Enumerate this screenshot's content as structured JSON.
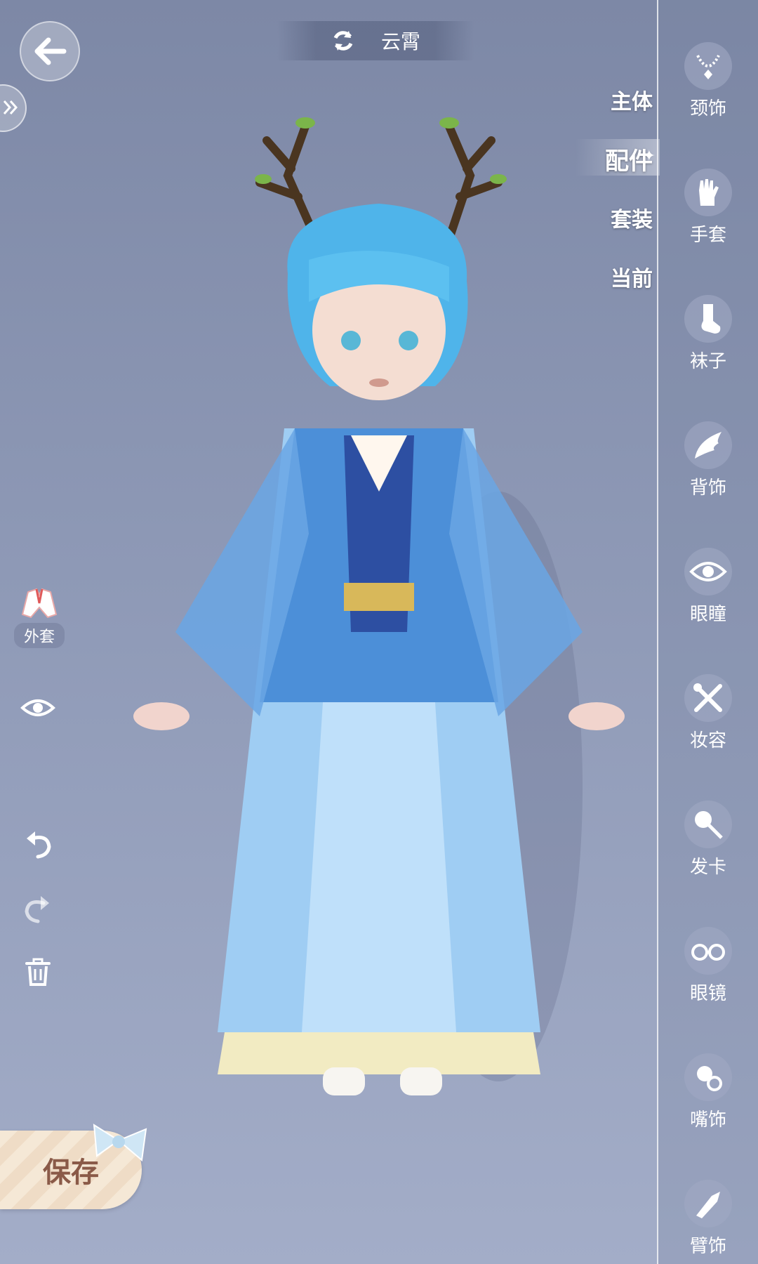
{
  "header": {
    "character_name": "云霄"
  },
  "tabs": [
    {
      "label": "主体",
      "active": false
    },
    {
      "label": "配件",
      "active": true
    },
    {
      "label": "套装",
      "active": false
    },
    {
      "label": "当前",
      "active": false
    }
  ],
  "sidebar": {
    "items": [
      {
        "label": "颈饰",
        "icon": "necklace-icon"
      },
      {
        "label": "手套",
        "icon": "glove-icon"
      },
      {
        "label": "袜子",
        "icon": "sock-icon"
      },
      {
        "label": "背饰",
        "icon": "wing-icon"
      },
      {
        "label": "眼瞳",
        "icon": "eye-icon"
      },
      {
        "label": "妆容",
        "icon": "makeup-brush-icon"
      },
      {
        "label": "发卡",
        "icon": "hairclip-icon"
      },
      {
        "label": "眼镜",
        "icon": "glasses-icon"
      },
      {
        "label": "嘴饰",
        "icon": "pacifier-icon"
      },
      {
        "label": "臂饰",
        "icon": "arm-accessory-icon"
      }
    ]
  },
  "left_panel": {
    "coat_label": "外套",
    "icons": [
      "coat-icon",
      "eye-toggle-icon",
      "undo-icon",
      "redo-icon",
      "trash-icon"
    ]
  },
  "save_label": "保存",
  "colors": {
    "background": "#8e99b6",
    "sidebar_border": "#ffffff",
    "save_text": "#8a5a48",
    "robe_blue": "#4c8fd8",
    "hair_blue": "#4fb4ea"
  }
}
